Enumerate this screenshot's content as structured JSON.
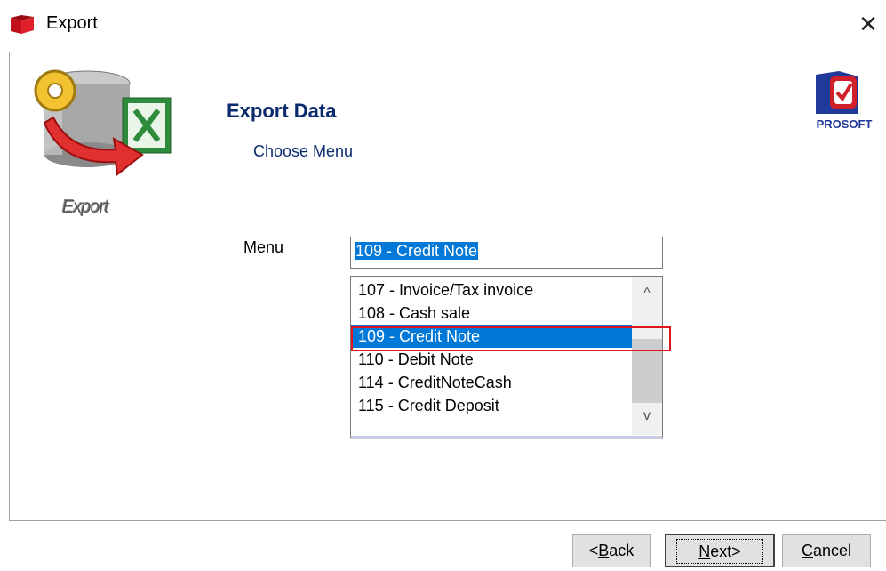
{
  "window": {
    "title": "Export",
    "close_glyph": "✕",
    "app_icon": "red-book-icon"
  },
  "header": {
    "title": "Export Data",
    "subtitle": "Choose Menu",
    "export_caption": "Export",
    "export_art_icon": "database-excel-export-icon",
    "logo_text": "PROSOFT",
    "logo_icon": "prosoft-logo"
  },
  "form": {
    "menu_label": "Menu",
    "menu_value": "109 - Credit Note",
    "list_items": [
      "107 - Invoice/Tax invoice",
      "108 - Cash sale",
      "109 - Credit Note",
      "110 - Debit Note",
      "114 - CreditNoteCash",
      "115 - Credit Deposit"
    ],
    "selected_index": 2,
    "scroll_up_glyph": "^",
    "scroll_down_glyph": "v"
  },
  "buttons": {
    "back_prefix": "<",
    "back_key": "B",
    "back_rest": "ack",
    "next_key": "N",
    "next_rest": "ext>",
    "cancel_key": "C",
    "cancel_rest": "ancel"
  },
  "colors": {
    "selection": "#0078d7",
    "highlight_border": "#e0141e",
    "heading": "#0a2a6e"
  }
}
